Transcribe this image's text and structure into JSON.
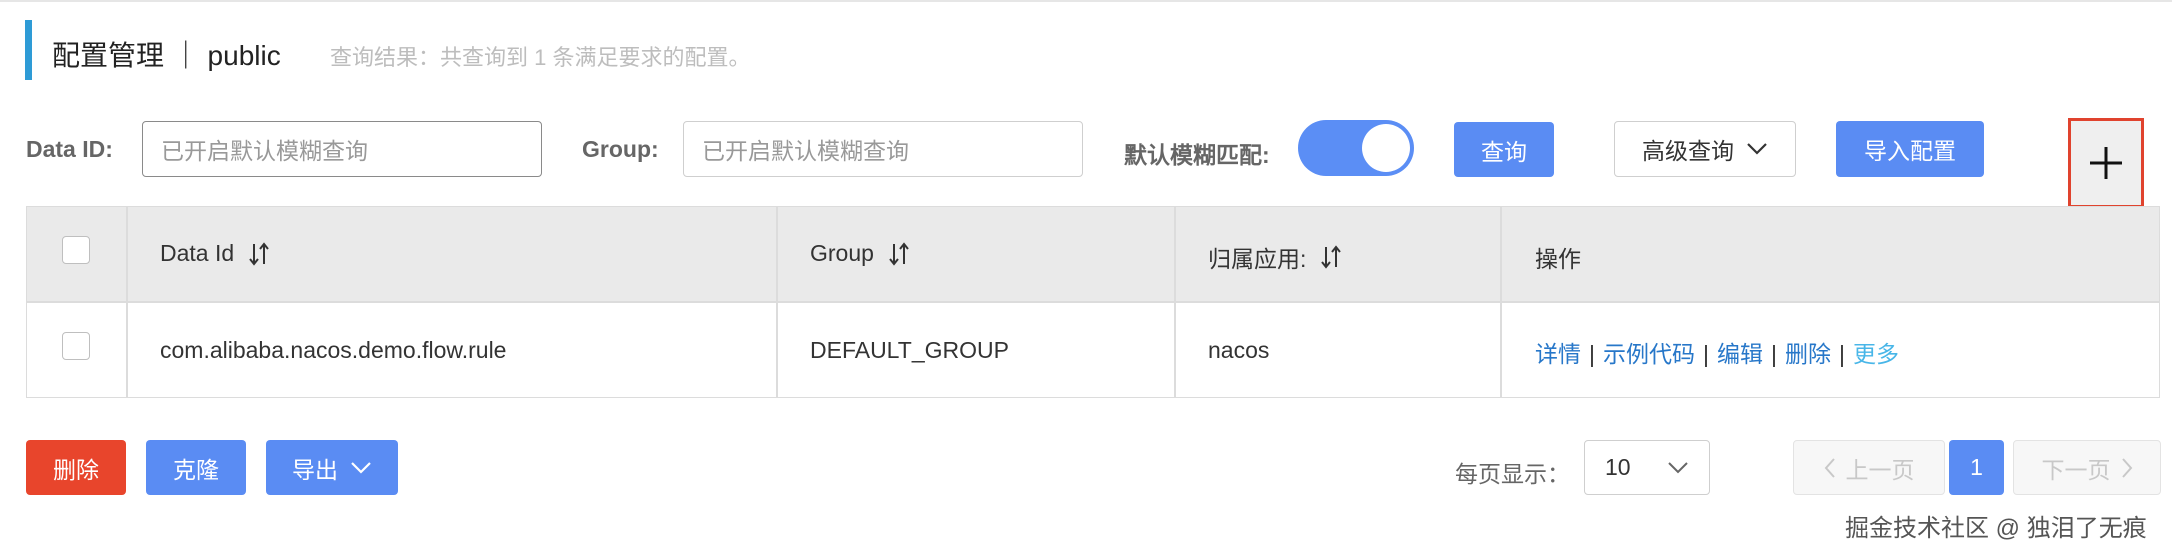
{
  "header": {
    "title": "配置管理 ｜ public",
    "result_text": "查询结果：共查询到 1 条满足要求的配置。"
  },
  "search": {
    "data_id_label": "Data ID:",
    "data_id_placeholder": "已开启默认模糊查询",
    "group_label": "Group:",
    "group_placeholder": "已开启默认模糊查询",
    "fuzzy_label": "默认模糊匹配:",
    "fuzzy_enabled": true,
    "query_button": "查询",
    "advanced_button": "高级查询",
    "import_button": "导入配置",
    "add_button_icon": "plus-icon"
  },
  "table": {
    "columns": [
      {
        "label": "Data Id"
      },
      {
        "label": "Group"
      },
      {
        "label": "归属应用:"
      },
      {
        "label": "操作"
      }
    ],
    "rows": [
      {
        "data_id": "com.alibaba.nacos.demo.flow.rule",
        "group": "DEFAULT_GROUP",
        "app": "nacos",
        "actions": [
          "详情",
          "示例代码",
          "编辑",
          "删除",
          "更多"
        ]
      }
    ],
    "separator": "|"
  },
  "footer": {
    "delete_button": "删除",
    "clone_button": "克隆",
    "export_button": "导出",
    "page_size_label": "每页显示：",
    "page_size_value": "10",
    "prev_button": "上一页",
    "current_page": "1",
    "next_button": "下一页"
  },
  "watermark": "掘金技术社区 @ 独泪了无痕",
  "colors": {
    "primary": "#5a8cf3",
    "danger": "#e8452c",
    "link": "#2777c9",
    "link_light": "#48b6e8",
    "highlight_border": "#e0432e"
  }
}
